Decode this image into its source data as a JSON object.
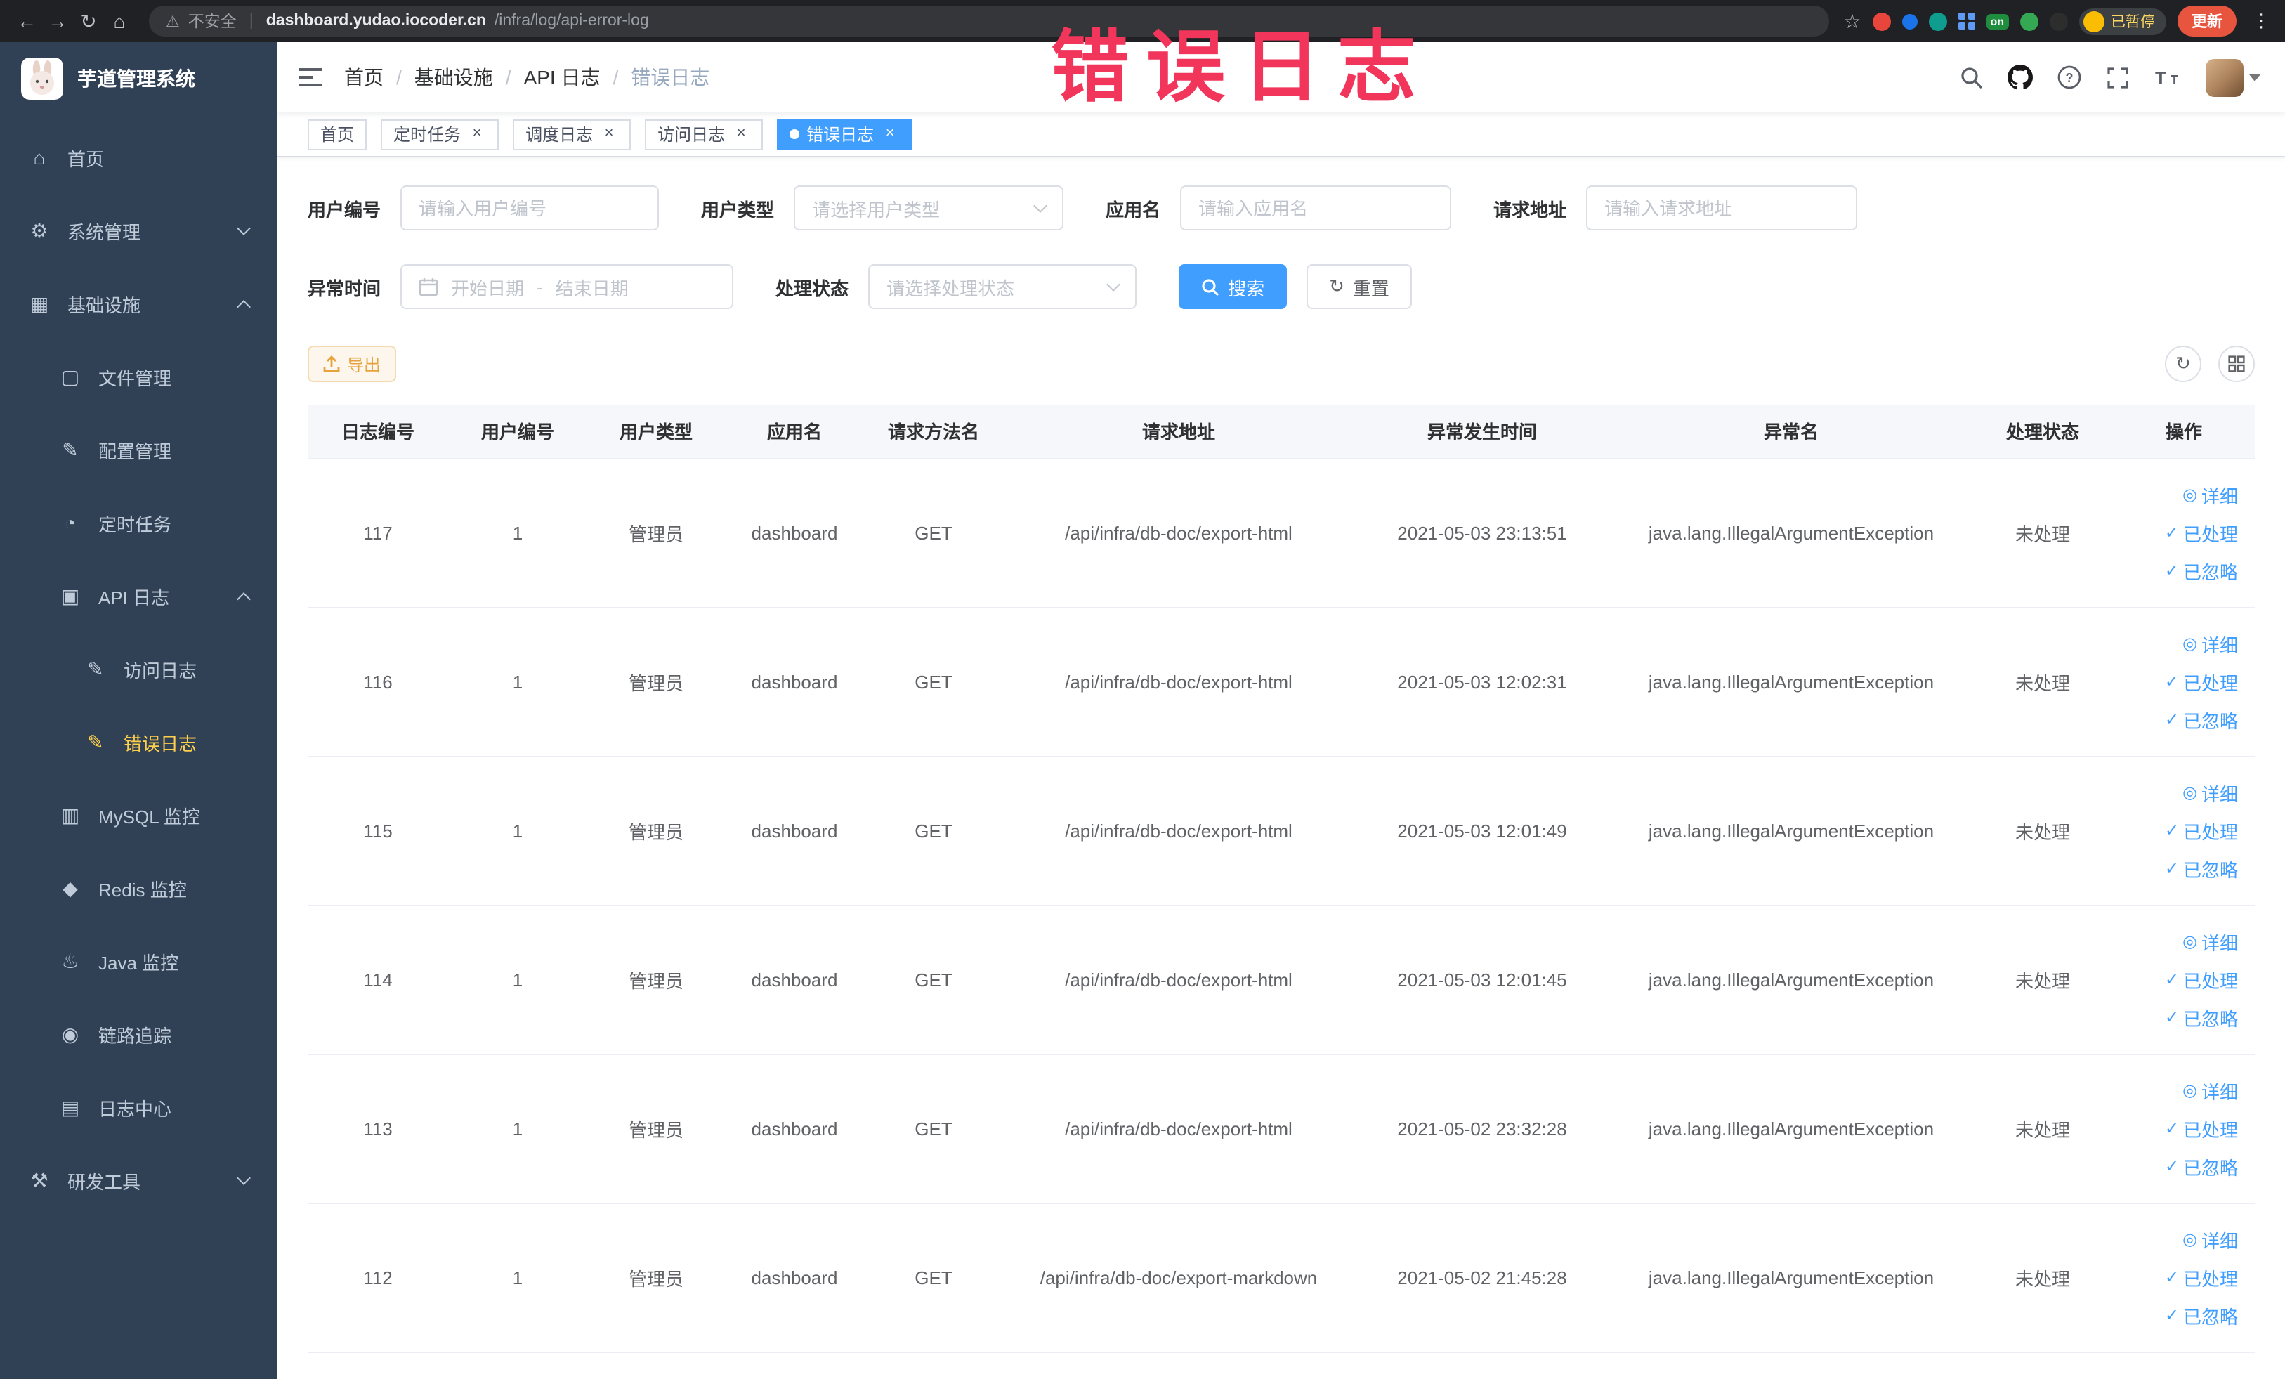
{
  "colors": {
    "accent": "#409eff",
    "sidebar_bg": "#304156",
    "menu_text": "#bfcbd9",
    "menu_active": "#ffd04b",
    "annotation": "#f2355b",
    "warning": "#e6a23c",
    "chrome_bg": "#202124",
    "update_badge": "#e8553e"
  },
  "browser": {
    "security_label": "不安全",
    "url_domain": "dashboard.yudao.iocoder.cn",
    "url_path": "/infra/log/api-error-log",
    "extension_on_badge": "on",
    "paused_badge": "已暂停",
    "update_button": "更新"
  },
  "annotation": "错误日志",
  "sidebar": {
    "logo_title": "芋道管理系统",
    "items": [
      {
        "label": "首页",
        "icon": "home-icon",
        "level": 1
      },
      {
        "label": "系统管理",
        "icon": "system-icon",
        "level": 1,
        "expand": "down"
      },
      {
        "label": "基础设施",
        "icon": "infra-icon",
        "level": 1,
        "expand": "up"
      },
      {
        "label": "文件管理",
        "icon": "file-icon",
        "level": 2
      },
      {
        "label": "配置管理",
        "icon": "config-icon",
        "level": 2
      },
      {
        "label": "定时任务",
        "icon": "timer-icon",
        "level": 2
      },
      {
        "label": "API 日志",
        "icon": "api-log-icon",
        "level": 2,
        "expand": "up"
      },
      {
        "label": "访问日志",
        "icon": "access-log-icon",
        "level": 3
      },
      {
        "label": "错误日志",
        "icon": "error-log-icon",
        "level": 3,
        "active": true
      },
      {
        "label": "MySQL 监控",
        "icon": "mysql-icon",
        "level": 2
      },
      {
        "label": "Redis 监控",
        "icon": "redis-icon",
        "level": 2
      },
      {
        "label": "Java 监控",
        "icon": "java-icon",
        "level": 2
      },
      {
        "label": "链路追踪",
        "icon": "trace-icon",
        "level": 2
      },
      {
        "label": "日志中心",
        "icon": "log-center-icon",
        "level": 2
      },
      {
        "label": "研发工具",
        "icon": "tools-icon",
        "level": 1,
        "expand": "down"
      }
    ]
  },
  "breadcrumb": [
    "首页",
    "基础设施",
    "API 日志",
    "错误日志"
  ],
  "tabs": [
    {
      "label": "首页",
      "closable": false,
      "active": false
    },
    {
      "label": "定时任务",
      "closable": true,
      "active": false
    },
    {
      "label": "调度日志",
      "closable": true,
      "active": false
    },
    {
      "label": "访问日志",
      "closable": true,
      "active": false
    },
    {
      "label": "错误日志",
      "closable": true,
      "active": true
    }
  ],
  "filters": {
    "user_id_label": "用户编号",
    "user_id_placeholder": "请输入用户编号",
    "user_type_label": "用户类型",
    "user_type_placeholder": "请选择用户类型",
    "app_name_label": "应用名",
    "app_name_placeholder": "请输入应用名",
    "request_url_label": "请求地址",
    "request_url_placeholder": "请输入请求地址",
    "exception_time_label": "异常时间",
    "start_date_placeholder": "开始日期",
    "range_separator": "-",
    "end_date_placeholder": "结束日期",
    "process_status_label": "处理状态",
    "process_status_placeholder": "请选择处理状态",
    "search_button": "搜索",
    "reset_button": "重置"
  },
  "toolbar": {
    "export_label": "导出"
  },
  "table": {
    "columns": [
      "日志编号",
      "用户编号",
      "用户类型",
      "应用名",
      "请求方法名",
      "请求地址",
      "异常发生时间",
      "异常名",
      "处理状态",
      "操作"
    ],
    "actions": {
      "detail": "详细",
      "processed": "已处理",
      "ignore": "已忽略"
    },
    "rows": [
      {
        "id": "117",
        "user_id": "1",
        "user_type": "管理员",
        "app": "dashboard",
        "method": "GET",
        "url": "/api/infra/db-doc/export-html",
        "time": "2021-05-03 23:13:51",
        "exception": "java.lang.IllegalArgumentException",
        "status": "未处理"
      },
      {
        "id": "116",
        "user_id": "1",
        "user_type": "管理员",
        "app": "dashboard",
        "method": "GET",
        "url": "/api/infra/db-doc/export-html",
        "time": "2021-05-03 12:02:31",
        "exception": "java.lang.IllegalArgumentException",
        "status": "未处理"
      },
      {
        "id": "115",
        "user_id": "1",
        "user_type": "管理员",
        "app": "dashboard",
        "method": "GET",
        "url": "/api/infra/db-doc/export-html",
        "time": "2021-05-03 12:01:49",
        "exception": "java.lang.IllegalArgumentException",
        "status": "未处理"
      },
      {
        "id": "114",
        "user_id": "1",
        "user_type": "管理员",
        "app": "dashboard",
        "method": "GET",
        "url": "/api/infra/db-doc/export-html",
        "time": "2021-05-03 12:01:45",
        "exception": "java.lang.IllegalArgumentException",
        "status": "未处理"
      },
      {
        "id": "113",
        "user_id": "1",
        "user_type": "管理员",
        "app": "dashboard",
        "method": "GET",
        "url": "/api/infra/db-doc/export-html",
        "time": "2021-05-02 23:32:28",
        "exception": "java.lang.IllegalArgumentException",
        "status": "未处理"
      },
      {
        "id": "112",
        "user_id": "1",
        "user_type": "管理员",
        "app": "dashboard",
        "method": "GET",
        "url": "/api/infra/db-doc/export-markdown",
        "time": "2021-05-02 21:45:28",
        "exception": "java.lang.IllegalArgumentException",
        "status": "未处理"
      }
    ]
  }
}
